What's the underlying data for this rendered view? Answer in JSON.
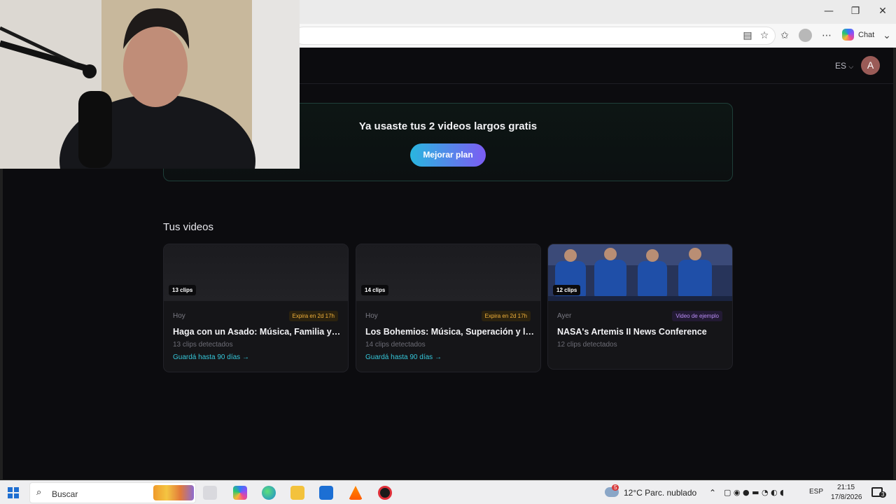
{
  "browser": {
    "copilot_label": "Chat",
    "window_controls": {
      "minimize": "—",
      "maximize": "❐",
      "close": "✕"
    }
  },
  "header": {
    "language": "ES",
    "avatar_initial": "A"
  },
  "promo": {
    "title": "Ya usaste tus 2 videos largos gratis",
    "button": "Mejorar plan"
  },
  "videos": {
    "section_title": "Tus videos",
    "items": [
      {
        "clips_badge": "13 clips",
        "date": "Hoy",
        "tag": "Expira en 2d 17h",
        "title": "Haga con un Asado: Música, Familia y Pasión",
        "clips_detected": "13 clips detectados",
        "save_link": "Guardá hasta 90 días →"
      },
      {
        "clips_badge": "14 clips",
        "date": "Hoy",
        "tag": "Expira en 2d 17h",
        "title": "Los Bohemios: Música, Superación y la Mo...",
        "clips_detected": "14 clips detectados",
        "save_link": "Guardá hasta 90 días →"
      },
      {
        "clips_badge": "12 clips",
        "date": "Ayer",
        "tag": "Video de ejemplo",
        "title": "NASA's Artemis II News Conference",
        "clips_detected": "12 clips detectados"
      }
    ]
  },
  "taskbar": {
    "search_placeholder": "Buscar",
    "weather_badge": "5",
    "weather": "12°C  Parc. nublado",
    "language": "ESP",
    "time": "21:15",
    "date": "17/8/2026",
    "notifications": "3"
  }
}
